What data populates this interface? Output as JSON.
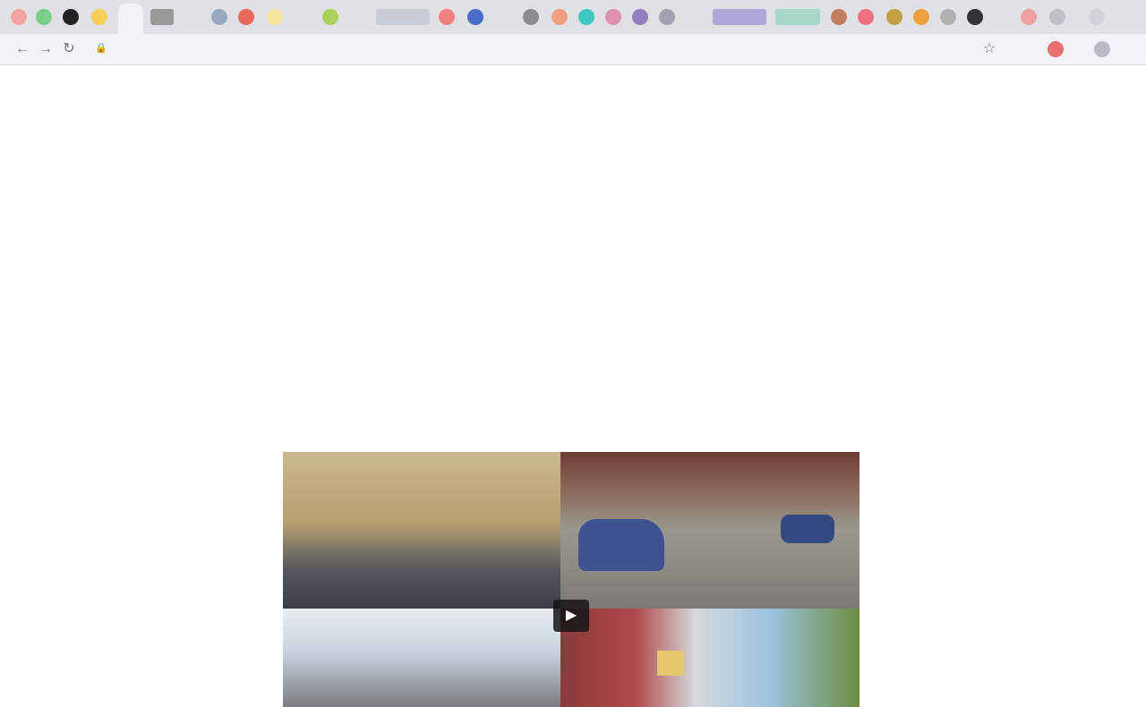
{
  "browser": {
    "address_bar": {
      "url": ""
    },
    "tabs_visible": true
  },
  "site": {
    "name": "",
    "tagline": ""
  },
  "article": {
    "headline": "",
    "byline": "",
    "section_heading": "",
    "paragraphs": [
      "",
      "",
      "",
      ""
    ],
    "caption": ""
  },
  "media": {
    "play_icon": "play-icon"
  },
  "colors": {
    "tab_strip": "#dfe1e5",
    "toolbar": "#f1f3f4",
    "page": "#ffffff"
  }
}
